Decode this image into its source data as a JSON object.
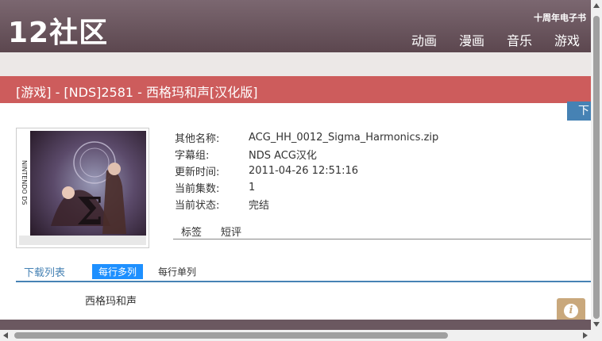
{
  "header": {
    "logo": "12社区",
    "tagline": "十周年电子书",
    "nav": [
      "动画",
      "漫画",
      "音乐",
      "游戏"
    ]
  },
  "title": "[游戏] - [NDS]2581 - 西格玛和声[汉化版]",
  "download_button": "下",
  "info": [
    {
      "label": "其他名称:",
      "value": "ACG_HH_0012_Sigma_Harmonics.zip"
    },
    {
      "label": "字幕组:",
      "value": "NDS ACG汉化"
    },
    {
      "label": "更新时间:",
      "value": "2011-04-26 12:51:16"
    },
    {
      "label": "当前集数:",
      "value": "1"
    },
    {
      "label": "当前状态:",
      "value": "完结"
    }
  ],
  "tabs": [
    "标签",
    "短评"
  ],
  "downloads": {
    "title": "下载列表",
    "view_multi": "每行多列",
    "view_single": "每行单列",
    "items": [
      "西格玛和声"
    ]
  },
  "cover": {
    "brand_text": "NINTENDO DS"
  },
  "colors": {
    "header": "#6b5860",
    "title_bar": "#cd5c5c",
    "accent": "#4682b4",
    "active_tab": "#1e90ff"
  }
}
